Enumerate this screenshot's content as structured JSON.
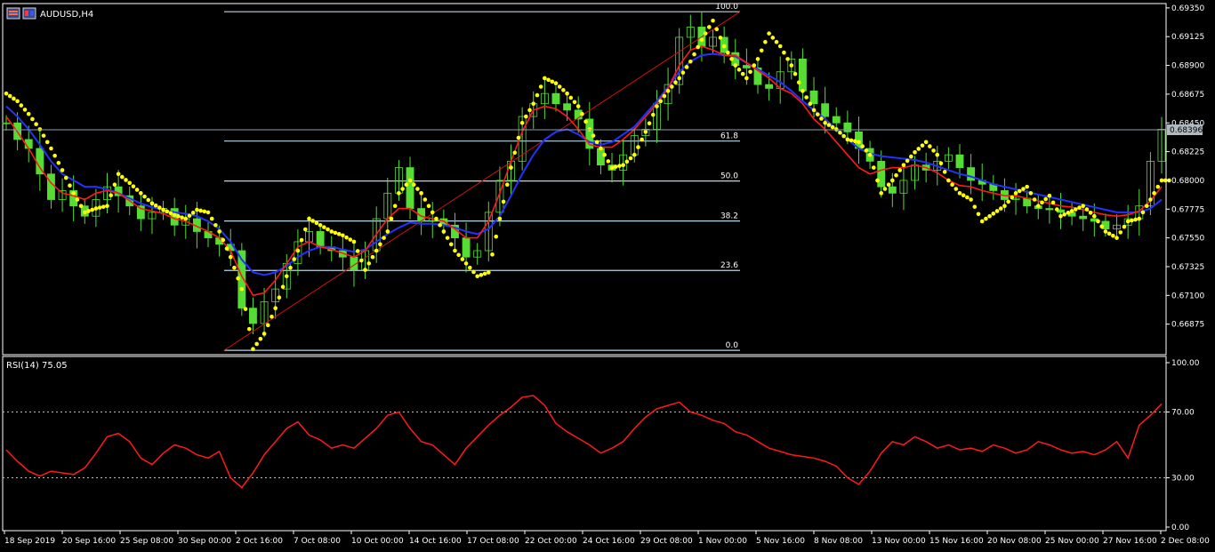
{
  "window": {
    "symbol_title": "AUDUSD,H4",
    "icon": "chart-window-icon"
  },
  "colors": {
    "background": "#000000",
    "grid_frame": "#ffffff",
    "candles": "#55dd33",
    "sma_fast": "#ff1a1a",
    "sma_slow": "#2233ff",
    "psar": "#ffff00",
    "fibo": "#b8d6e6",
    "trendline": "#cc1111",
    "rsi": "#ff1a1a",
    "current_price_line": "#8aa0b0"
  },
  "chart_data": [
    {
      "type": "line",
      "name": "price",
      "title": "AUDUSD,H4",
      "ylim": [
        0.6665,
        0.6937
      ],
      "x_tick_labels": [
        "18 Sep 2019",
        "20 Sep 16:00",
        "25 Sep 08:00",
        "30 Sep 00:00",
        "2 Oct 16:00",
        "7 Oct 08:00",
        "10 Oct 00:00",
        "14 Oct 16:00",
        "17 Oct 08:00",
        "22 Oct 00:00",
        "24 Oct 16:00",
        "29 Oct 08:00",
        "1 Nov 00:00",
        "5 Nov 16:00",
        "8 Nov 08:00",
        "13 Nov 00:00",
        "15 Nov 16:00",
        "20 Nov 08:00",
        "25 Nov 00:00",
        "27 Nov 16:00",
        "2 Dec 08:00"
      ],
      "y_tick_labels": [
        "0.69350",
        "0.69125",
        "0.68900",
        "0.68675",
        "0.68450",
        "0.68225",
        "0.68000",
        "0.67775",
        "0.67550",
        "0.67325",
        "0.67100",
        "0.66875"
      ],
      "current_price": "0.68396",
      "fibonacci": {
        "levels": [
          "100.0",
          "61.8",
          "50.0",
          "38.2",
          "23.6",
          "0.0"
        ],
        "ratios": [
          1.0,
          0.618,
          0.5,
          0.382,
          0.236,
          0.0
        ],
        "high": 0.6932,
        "low": 0.6667
      },
      "series": [
        {
          "name": "close",
          "values": [
            0.6845,
            0.6832,
            0.6825,
            0.6805,
            0.6785,
            0.6792,
            0.678,
            0.6772,
            0.6785,
            0.6795,
            0.6788,
            0.678,
            0.677,
            0.6775,
            0.6778,
            0.6765,
            0.677,
            0.676,
            0.6755,
            0.675,
            0.6745,
            0.67,
            0.6688,
            0.6705,
            0.6715,
            0.6735,
            0.6752,
            0.676,
            0.6748,
            0.6745,
            0.674,
            0.673,
            0.6745,
            0.677,
            0.679,
            0.681,
            0.6778,
            0.6768,
            0.677,
            0.6765,
            0.6755,
            0.674,
            0.6745,
            0.6775,
            0.68,
            0.6815,
            0.685,
            0.686,
            0.6868,
            0.686,
            0.6855,
            0.6848,
            0.6825,
            0.6812,
            0.6808,
            0.682,
            0.6835,
            0.684,
            0.686,
            0.6875,
            0.6912,
            0.692,
            0.6905,
            0.6912,
            0.69,
            0.689,
            0.6888,
            0.6875,
            0.6872,
            0.6885,
            0.6895,
            0.687,
            0.686,
            0.685,
            0.6845,
            0.6838,
            0.6825,
            0.6815,
            0.6795,
            0.679,
            0.68,
            0.6812,
            0.6808,
            0.6815,
            0.682,
            0.681,
            0.68,
            0.6797,
            0.6792,
            0.6785,
            0.6786,
            0.678,
            0.6778,
            0.6777,
            0.6775,
            0.6772,
            0.677,
            0.6768,
            0.6762,
            0.6765,
            0.677,
            0.678,
            0.6815,
            0.684
          ]
        },
        {
          "name": "sma_fast",
          "values": [
            0.685,
            0.6838,
            0.6825,
            0.681,
            0.6798,
            0.679,
            0.6788,
            0.6785,
            0.679,
            0.6792,
            0.679,
            0.6784,
            0.6778,
            0.6776,
            0.6774,
            0.677,
            0.6768,
            0.6764,
            0.676,
            0.6755,
            0.6745,
            0.6725,
            0.671,
            0.6712,
            0.6722,
            0.6735,
            0.6748,
            0.6752,
            0.6748,
            0.6746,
            0.6743,
            0.674,
            0.6745,
            0.6758,
            0.677,
            0.6778,
            0.6778,
            0.6772,
            0.677,
            0.6768,
            0.6762,
            0.6755,
            0.6755,
            0.6768,
            0.679,
            0.6815,
            0.6838,
            0.6855,
            0.6858,
            0.6856,
            0.685,
            0.684,
            0.6828,
            0.6826,
            0.6826,
            0.6832,
            0.684,
            0.685,
            0.686,
            0.6872,
            0.689,
            0.6902,
            0.6905,
            0.6902,
            0.6898,
            0.6898,
            0.6892,
            0.6886,
            0.688,
            0.6872,
            0.6868,
            0.686,
            0.6848,
            0.684,
            0.683,
            0.682,
            0.681,
            0.6805,
            0.6808,
            0.681,
            0.681,
            0.6812,
            0.681,
            0.6806,
            0.68,
            0.6796,
            0.6795,
            0.6792,
            0.679,
            0.6788,
            0.6788,
            0.6786,
            0.6784,
            0.6782,
            0.678,
            0.6779,
            0.6777,
            0.6775,
            0.6773,
            0.6772,
            0.6773,
            0.6776,
            0.6784,
            0.6795
          ]
        },
        {
          "name": "sma_slow",
          "values": [
            0.6858,
            0.685,
            0.684,
            0.6828,
            0.6815,
            0.6805,
            0.68,
            0.6795,
            0.6795,
            0.6793,
            0.679,
            0.6786,
            0.6782,
            0.6779,
            0.6777,
            0.6775,
            0.6774,
            0.6772,
            0.6768,
            0.6762,
            0.6752,
            0.6738,
            0.6728,
            0.6726,
            0.6728,
            0.6733,
            0.674,
            0.6745,
            0.6748,
            0.6748,
            0.6746,
            0.6744,
            0.6746,
            0.6752,
            0.6758,
            0.6763,
            0.6767,
            0.6766,
            0.6766,
            0.6765,
            0.6763,
            0.676,
            0.6758,
            0.6762,
            0.6772,
            0.6788,
            0.6805,
            0.682,
            0.6832,
            0.6838,
            0.684,
            0.6836,
            0.683,
            0.6828,
            0.683,
            0.6836,
            0.6842,
            0.6852,
            0.6862,
            0.6873,
            0.6885,
            0.6893,
            0.6898,
            0.6899,
            0.6898,
            0.6897,
            0.6892,
            0.6887,
            0.6882,
            0.6877,
            0.687,
            0.6862,
            0.6855,
            0.6848,
            0.684,
            0.6832,
            0.6825,
            0.6821,
            0.6819,
            0.6818,
            0.6817,
            0.6816,
            0.6814,
            0.6811,
            0.6808,
            0.6805,
            0.6803,
            0.68,
            0.6797,
            0.6795,
            0.6793,
            0.6791,
            0.6789,
            0.6787,
            0.6785,
            0.6783,
            0.6781,
            0.6779,
            0.6777,
            0.6775,
            0.6775,
            0.6775,
            0.6778,
            0.6785
          ]
        },
        {
          "name": "psar",
          "values": [
            0.6868,
            0.6862,
            0.6852,
            0.684,
            0.6825,
            0.6808,
            0.679,
            0.6775,
            0.6778,
            0.678,
            0.6805,
            0.6798,
            0.679,
            0.6782,
            0.6777,
            0.6773,
            0.677,
            0.6777,
            0.6775,
            0.676,
            0.674,
            0.6715,
            0.6668,
            0.668,
            0.67,
            0.6725,
            0.6745,
            0.677,
            0.6765,
            0.676,
            0.6757,
            0.6752,
            0.673,
            0.6745,
            0.676,
            0.679,
            0.68,
            0.679,
            0.6775,
            0.676,
            0.6745,
            0.6735,
            0.6725,
            0.6728,
            0.677,
            0.681,
            0.6845,
            0.686,
            0.688,
            0.6876,
            0.6868,
            0.6858,
            0.684,
            0.6825,
            0.681,
            0.6812,
            0.682,
            0.6838,
            0.6858,
            0.687,
            0.688,
            0.6893,
            0.691,
            0.6925,
            0.6905,
            0.689,
            0.688,
            0.6895,
            0.6915,
            0.6905,
            0.689,
            0.687,
            0.6855,
            0.6845,
            0.684,
            0.6832,
            0.683,
            0.682,
            0.679,
            0.68,
            0.6812,
            0.6822,
            0.683,
            0.682,
            0.68,
            0.679,
            0.6785,
            0.6768,
            0.6774,
            0.678,
            0.679,
            0.6795,
            0.678,
            0.6788,
            0.6772,
            0.6776,
            0.678,
            0.6772,
            0.676,
            0.6755,
            0.6768,
            0.677,
            0.6785,
            0.68
          ]
        }
      ]
    },
    {
      "type": "line",
      "name": "rsi",
      "title": "RSI(14) 75.05",
      "ylim": [
        0,
        100
      ],
      "levels": [
        70,
        30
      ],
      "y_tick_labels": [
        "100.00",
        "70.00",
        "30.00",
        "0.00"
      ],
      "series": [
        {
          "name": "RSI(14)",
          "values": [
            47,
            40,
            34,
            31,
            34,
            33,
            32,
            36,
            45,
            55,
            57,
            52,
            42,
            38,
            45,
            50,
            48,
            44,
            42,
            46,
            30,
            24,
            33,
            44,
            52,
            60,
            64,
            56,
            53,
            48,
            50,
            48,
            54,
            60,
            68,
            70,
            60,
            52,
            50,
            44,
            38,
            48,
            55,
            62,
            68,
            73,
            79,
            80,
            74,
            63,
            58,
            54,
            50,
            45,
            48,
            52,
            60,
            67,
            72,
            74,
            76,
            70,
            68,
            65,
            63,
            58,
            56,
            52,
            48,
            46,
            44,
            43,
            42,
            40,
            37,
            30,
            26,
            34,
            45,
            52,
            50,
            55,
            52,
            48,
            50,
            47,
            48,
            46,
            50,
            48,
            45,
            47,
            52,
            50,
            47,
            45,
            46,
            44,
            47,
            52,
            42,
            62,
            68,
            75
          ]
        }
      ]
    }
  ]
}
